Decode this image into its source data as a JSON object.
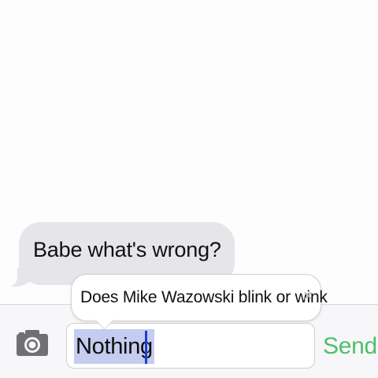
{
  "conversation": {
    "messages": [
      {
        "direction": "received",
        "text": "Babe what's wrong?"
      }
    ]
  },
  "autocorrect": {
    "suggestion": "Does Mike Wazowski blink or wink",
    "dismiss_glyph": "×"
  },
  "composer": {
    "typed_text": "Nothing",
    "send_label": "Send",
    "camera_icon": "camera-icon"
  },
  "colors": {
    "received_bubble": "#e6e5ea",
    "send_label": "#4fbf6a",
    "selection": "#c4ccf0",
    "cursor": "#1d3fc8"
  }
}
